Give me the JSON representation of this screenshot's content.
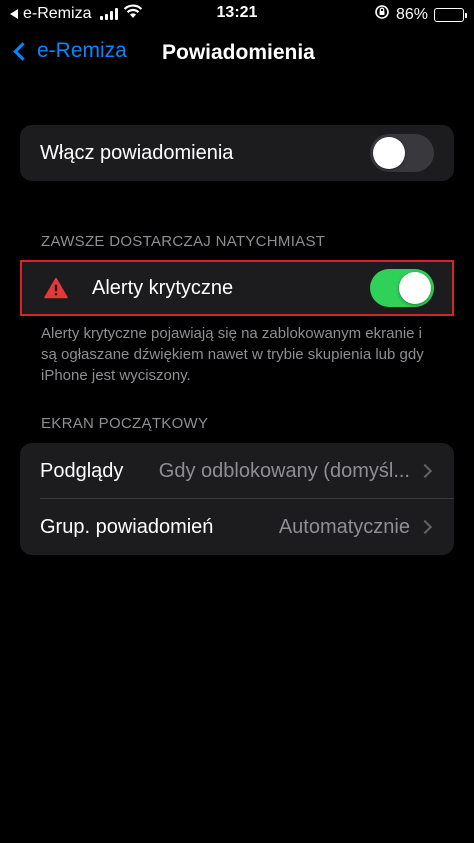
{
  "status_bar": {
    "carrier_back": "e-Remiza",
    "time": "13:21",
    "battery_percent": "86%",
    "battery_level": 0.86
  },
  "nav": {
    "back_label": "e-Remiza",
    "title": "Powiadomienia"
  },
  "enable_notifications": {
    "label": "Włącz powiadomienia",
    "toggle_on": false
  },
  "always_deliver": {
    "header": "ZAWSZE DOSTARCZAJ NATYCHMIAST",
    "critical_alerts_label": "Alerty krytyczne",
    "toggle_on": true,
    "footer": "Alerty krytyczne pojawiają się na zablokowanym ekranie i są ogłaszane dźwiękiem nawet w trybie skupienia lub gdy iPhone jest wyciszony."
  },
  "home_screen": {
    "header": "EKRAN POCZĄTKOWY",
    "rows": [
      {
        "label": "Podglądy",
        "value": "Gdy odblokowany (domyśl..."
      },
      {
        "label": "Grup. powiadomień",
        "value": "Automatycznie"
      }
    ]
  },
  "colors": {
    "accent": "#0a84ff",
    "toggle_on": "#30d158",
    "warning": "#e5383b",
    "highlight_border": "#d6242c"
  }
}
